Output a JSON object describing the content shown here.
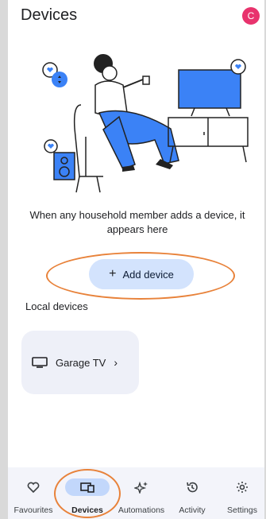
{
  "header": {
    "title": "Devices",
    "avatar_initial": "C"
  },
  "empty_state": {
    "message": "When any household member adds a device, it appears here"
  },
  "add_device": {
    "label": "Add device"
  },
  "local_devices": {
    "section_label": "Local devices",
    "items": [
      {
        "name": "Garage TV",
        "icon": "tv-icon"
      }
    ]
  },
  "bottom_nav": {
    "items": [
      {
        "label": "Favourites",
        "icon": "heart-icon"
      },
      {
        "label": "Devices",
        "icon": "devices-icon",
        "active": true
      },
      {
        "label": "Automations",
        "icon": "sparkle-icon"
      },
      {
        "label": "Activity",
        "icon": "history-icon"
      },
      {
        "label": "Settings",
        "icon": "gear-icon"
      }
    ]
  },
  "colors": {
    "accent_button": "#d3e3fd",
    "avatar": "#e8336d",
    "illustration_blue": "#3b82f6",
    "annotation_orange": "#e8823a"
  }
}
